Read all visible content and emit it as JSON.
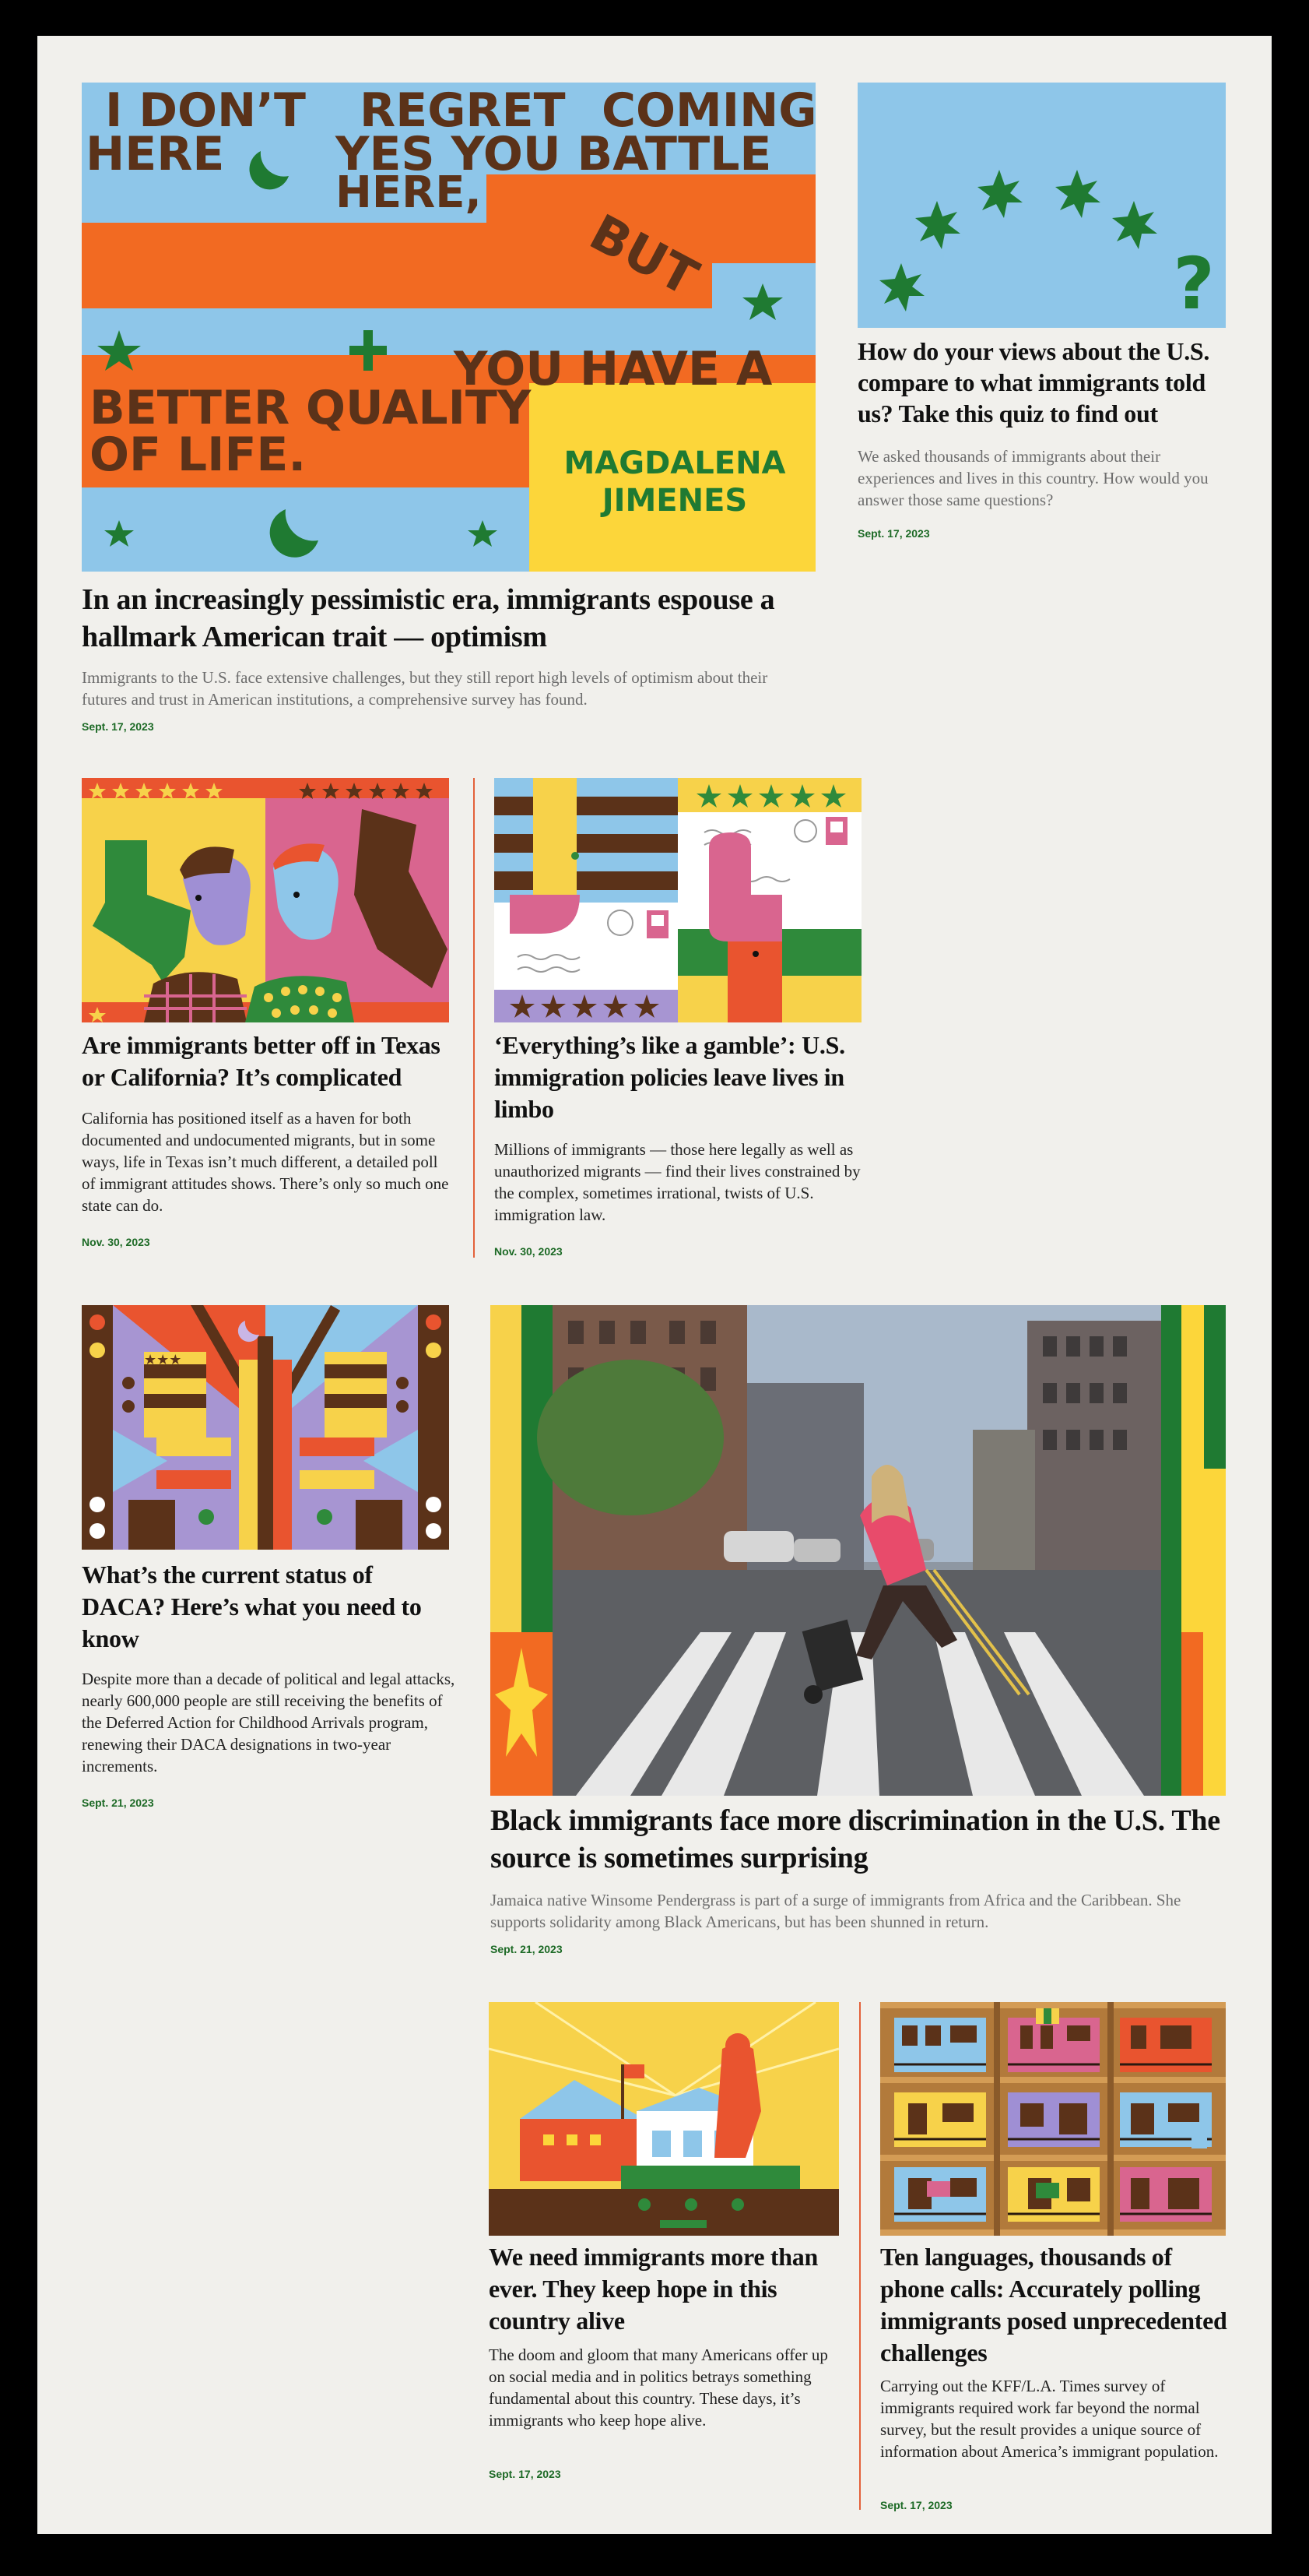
{
  "colors": {
    "frame": "#000000",
    "page_bg": "#f1f0ec",
    "date_green": "#1d6a26",
    "divider_orange": "#e3613a",
    "art_blue": "#8ec6e9",
    "art_orange": "#f26a22",
    "art_yellow": "#fcd63a",
    "art_green": "#1f7a32",
    "art_brown": "#5b3219",
    "art_pink": "#d9658f"
  },
  "articles": [
    {
      "id": "optimism",
      "headline": "In an increasingly pessimistic era, immigrants espouse a hallmark American trait — optimism",
      "dek": "Immigrants to the U.S. face extensive challenges, but they still report high levels of optimism about their futures and trust in American institutions, a comprehensive survey has found.",
      "date": "Sept. 17, 2023",
      "art": {
        "poster_lines": [
          "I DON’T",
          "REGRET",
          "COMING",
          "HERE",
          "YES YOU BATTLE",
          "HERE,",
          "BUT",
          "YOU HAVE A",
          "BETTER QUALITY",
          "OF LIFE."
        ],
        "poster_signature": [
          "MAGDALENA",
          "JIMENES"
        ],
        "icons": [
          "crescent-moon-icon",
          "star-icon",
          "plus-icon"
        ]
      }
    },
    {
      "id": "quiz",
      "headline": "How do your views about the U.S. compare to what immigrants told us? Take this quiz to find out",
      "dek": "We asked thousands of immigrants about their experiences and lives in this country. How would you answer those same questions?",
      "date": "Sept. 17, 2023",
      "art": {
        "glyph": "?",
        "icons": [
          "star-icon",
          "question-mark-icon"
        ]
      }
    },
    {
      "id": "texas-california",
      "headline": "Are immigrants better off in Texas or California? It’s complicated",
      "dek": "California has positioned itself as a haven for both documented and undocumented migrants, but in some ways, life in Texas isn’t much different, a detailed poll of immigrant attitudes shows. There’s only so much one state can do.",
      "date": "Nov. 30, 2023",
      "art": {
        "icons": [
          "texas-map-icon",
          "california-map-icon",
          "person-icon"
        ]
      }
    },
    {
      "id": "gamble",
      "headline": "‘Everything’s like a gamble’: U.S. immigration policies leave lives in limbo",
      "dek": "Millions of immigrants — those here legally as well as unauthorized migrants — find their lives constrained by the complex, sometimes irrational, twists of U.S. immigration law.",
      "date": "Nov. 30, 2023",
      "art": {
        "icons": [
          "hand-icon",
          "envelope-icon",
          "stamp-icon",
          "star-icon"
        ]
      }
    },
    {
      "id": "daca",
      "headline": "What’s the current status of DACA? Here’s what you need to know",
      "dek": "Despite more than a decade of political and legal attacks, nearly 600,000 people are still receiving the benefits of the Deferred Action for Childhood Arrivals program, renewing their DACA designations in two-year increments.",
      "date": "Sept. 21, 2023",
      "art": {
        "icons": [
          "geometric-pattern-icon",
          "star-icon"
        ]
      }
    },
    {
      "id": "black-immigrants",
      "headline": "Black immigrants face more discrimination in the U.S. The source is sometimes surprising",
      "dek": "Jamaica native Winsome Pendergrass is part of a surge of immigrants from Africa and the Caribbean. She supports solidarity among Black Americans, but has been shunned in return.",
      "date": "Sept. 21, 2023",
      "art": {
        "icons": [
          "photo-street-crossing",
          "star-icon"
        ]
      }
    },
    {
      "id": "keep-hope",
      "headline": "We need immigrants more than ever. They keep hope in this country alive",
      "dek": "The doom and gloom that many Americans offer up on social media and in politics betrays something fundamental about this country. These days, it’s immigrants who keep hope alive.",
      "date": "Sept. 17, 2023",
      "art": {
        "icons": [
          "house-icon",
          "person-icon",
          "flag-icon"
        ]
      }
    },
    {
      "id": "ten-languages",
      "headline": "Ten languages, thousands of phone calls: Accurately polling immigrants posed unprecedented challenges",
      "dek": "Carrying out the KFF/L.A. Times survey of immigrants required work far beyond the normal survey, but the result provides a unique source of information about America’s immigrant population.",
      "date": "Sept. 17, 2023",
      "art": {
        "icons": [
          "apartment-window-icon",
          "bookshelf-icon",
          "flag-icon"
        ]
      }
    }
  ]
}
